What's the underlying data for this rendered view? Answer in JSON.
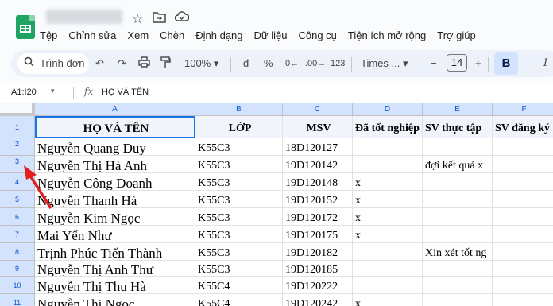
{
  "menu": [
    "Tệp",
    "Chỉnh sửa",
    "Xem",
    "Chèn",
    "Định dạng",
    "Dữ liệu",
    "Công cụ",
    "Tiện ích mở rộng",
    "Trợ giúp"
  ],
  "toolbar": {
    "search_placeholder": "Trình đơn",
    "zoom": "100%",
    "currency": "đ",
    "percent": "%",
    "dec_decrease": ".0",
    "dec_increase": ".00",
    "number_format": "123",
    "font": "Times ...",
    "font_size": "14",
    "minus": "−",
    "plus": "+",
    "bold": "B"
  },
  "formula_bar": {
    "name_box": "A1:I20",
    "fx": "fx",
    "value": "HỌ VÀ TÊN"
  },
  "columns": [
    "A",
    "B",
    "C",
    "D",
    "E",
    "F"
  ],
  "rows": [
    {
      "num": "1",
      "cells": [
        "HỌ VÀ TÊN",
        "LỚP",
        "MSV",
        "Đã tốt nghiệp",
        "SV thực tập",
        "SV đăng ký"
      ]
    },
    {
      "num": "2",
      "cells": [
        "Nguyễn Quang Duy",
        "K55C3",
        "18D120127",
        "",
        "",
        ""
      ]
    },
    {
      "num": "3",
      "cells": [
        "Nguyễn Thị Hà Anh",
        "K55C3",
        "19D120142",
        "",
        "đợi kết quả x",
        ""
      ]
    },
    {
      "num": "4",
      "cells": [
        "Nguyễn Công Doanh",
        "K55C3",
        "19D120148",
        "x",
        "",
        ""
      ]
    },
    {
      "num": "5",
      "cells": [
        "Nguyễn Thanh Hà",
        "K55C3",
        "19D120152",
        "x",
        "",
        ""
      ]
    },
    {
      "num": "6",
      "cells": [
        "Nguyễn Kim Ngọc",
        "K55C3",
        "19D120172",
        "x",
        "",
        ""
      ]
    },
    {
      "num": "7",
      "cells": [
        "Mai Yến Như",
        "K55C3",
        "19D120175",
        "x",
        "",
        ""
      ]
    },
    {
      "num": "8",
      "cells": [
        "Trịnh Phúc Tiến Thành",
        "K55C3",
        "19D120182",
        "",
        "Xin xét tốt ng",
        ""
      ]
    },
    {
      "num": "9",
      "cells": [
        "Nguyễn Thị Anh Thư",
        "K55C3",
        "19D120185",
        "",
        "",
        ""
      ]
    },
    {
      "num": "10",
      "cells": [
        "Nguyễn Thị Thu Hà",
        "K55C4",
        "19D120222",
        "",
        "",
        ""
      ]
    },
    {
      "num": "11",
      "cells": [
        "Nguyễn Thị Ngọc",
        "K55C4",
        "19D120242",
        "x",
        "",
        ""
      ]
    }
  ],
  "colors": {
    "accent": "#0b57d0",
    "header_fill": "#d3e3fd",
    "arrow": "#e02020"
  }
}
